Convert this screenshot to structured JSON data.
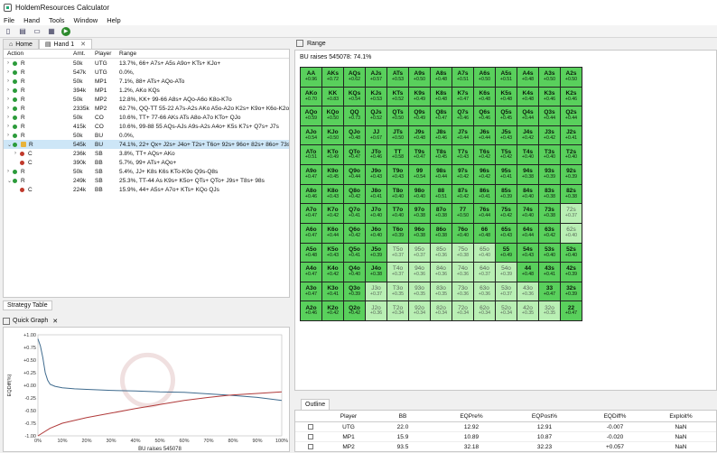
{
  "window": {
    "title": "HoldemResources Calculator"
  },
  "menu": [
    "File",
    "Hand",
    "Tools",
    "Window",
    "Help"
  ],
  "tabs": {
    "home": "Home",
    "hand": "Hand 1"
  },
  "tree": {
    "headers": {
      "action": "Action",
      "amt": "Amt.",
      "player": "Player",
      "range": "Range"
    },
    "rows": [
      {
        "indent": 0,
        "exp": "›",
        "dot": "g",
        "action": "R",
        "amt": "50k",
        "player": "UTG",
        "range": "13.7%, 66+ A7s+ A5s A9o+ KTs+ KJo+"
      },
      {
        "indent": 0,
        "exp": "›",
        "dot": "g",
        "action": "R",
        "amt": "547k",
        "player": "UTG",
        "range": "0.0%,"
      },
      {
        "indent": 0,
        "exp": "›",
        "dot": "g",
        "action": "R",
        "amt": "50k",
        "player": "MP1",
        "range": "7.1%, 88+ ATs+ AQo-ATo"
      },
      {
        "indent": 0,
        "exp": "›",
        "dot": "g",
        "action": "R",
        "amt": "394k",
        "player": "MP1",
        "range": "1.2%, AKo KQs"
      },
      {
        "indent": 0,
        "exp": "›",
        "dot": "g",
        "action": "R",
        "amt": "50k",
        "player": "MP2",
        "range": "12.8%, KK+ 99-66 A8s+ AQo-A6o K8o-K7o"
      },
      {
        "indent": 0,
        "exp": "›",
        "dot": "g",
        "action": "R",
        "amt": "2335k",
        "player": "MP2",
        "range": "62.7%, QQ-TT 55-22 A7s-A2s AKo A5o-A2o K2s+ K9o+ K6o-K2o"
      },
      {
        "indent": 0,
        "exp": "›",
        "dot": "g",
        "action": "R",
        "amt": "50k",
        "player": "CO",
        "range": "10.6%, TT+ 77-66 AKs ATs A8o-A7o KTo+ QJo"
      },
      {
        "indent": 0,
        "exp": "›",
        "dot": "g",
        "action": "R",
        "amt": "415k",
        "player": "CO",
        "range": "10.6%, 99-88 55 AQs-AJs A9s-A2s A4o+ K5s K7s+ Q7s+ J7s"
      },
      {
        "indent": 0,
        "exp": "›",
        "dot": "g",
        "action": "R",
        "amt": "50k",
        "player": "BU",
        "range": "0.0%,"
      },
      {
        "indent": 0,
        "exp": "⌄",
        "dot": "g",
        "action": "R",
        "amt": "545k",
        "player": "BU",
        "range": "74.1%, 22+ Qx+ J2s+ J4o+ T2s+ T6o+ 92s+ 96o+ 82s+ 86o+ 73s",
        "sel": true,
        "lock": true
      },
      {
        "indent": 1,
        "exp": "›",
        "dot": "r",
        "action": "C",
        "amt": "236k",
        "player": "SB",
        "range": "3.8%, TT+ AQs+ AKo"
      },
      {
        "indent": 1,
        "exp": "",
        "dot": "r",
        "action": "C",
        "amt": "390k",
        "player": "BB",
        "range": "5.7%, 99+ ATs+ AQo+"
      },
      {
        "indent": 0,
        "exp": "›",
        "dot": "g",
        "action": "R",
        "amt": "50k",
        "player": "SB",
        "range": "5.4%, JJ+ K8s K6s KTo-K9o Q9s-Q8s"
      },
      {
        "indent": 0,
        "exp": "⌄",
        "dot": "g",
        "action": "R",
        "amt": "249k",
        "player": "SB",
        "range": "25.3%, TT-44 As K9s+ K5o+ QTs+ QTo+ J9s+ T8s+ 98s"
      },
      {
        "indent": 1,
        "exp": "",
        "dot": "r",
        "action": "C",
        "amt": "224k",
        "player": "BB",
        "range": "15.9%, 44+ A5s+ A7o+ KTs+ KQo QJs"
      }
    ]
  },
  "strategy_tab": "Strategy Table",
  "quick_graph": {
    "label": "Quick Graph"
  },
  "range_pane": {
    "label": "Range",
    "title": "BU raises 545078: 74.1%"
  },
  "range_grid": {
    "cells": [
      [
        "AA",
        "+0.96",
        1
      ],
      [
        "AKs",
        "+0.72",
        1
      ],
      [
        "AQs",
        "+0.62",
        1
      ],
      [
        "AJs",
        "+0.57",
        1
      ],
      [
        "ATs",
        "+0.53",
        1
      ],
      [
        "A9s",
        "+0.50",
        1
      ],
      [
        "A8s",
        "+0.48",
        1
      ],
      [
        "A7s",
        "+0.51",
        1
      ],
      [
        "A6s",
        "+0.50",
        1
      ],
      [
        "A5s",
        "+0.51",
        1
      ],
      [
        "A4s",
        "+0.48",
        1
      ],
      [
        "A3s",
        "+0.50",
        1
      ],
      [
        "A2s",
        "+0.50",
        1
      ],
      [
        "AKo",
        "+0.70",
        1
      ],
      [
        "KK",
        "+0.83",
        1
      ],
      [
        "KQs",
        "+0.54",
        1
      ],
      [
        "KJs",
        "+0.53",
        1
      ],
      [
        "KTs",
        "+0.52",
        1
      ],
      [
        "K9s",
        "+0.49",
        1
      ],
      [
        "K8s",
        "+0.48",
        1
      ],
      [
        "K7s",
        "+0.47",
        1
      ],
      [
        "K6s",
        "+0.48",
        1
      ],
      [
        "K5s",
        "+0.48",
        1
      ],
      [
        "K4s",
        "+0.48",
        1
      ],
      [
        "K3s",
        "+0.46",
        1
      ],
      [
        "K2s",
        "+0.46",
        1
      ],
      [
        "AQo",
        "+0.59",
        1
      ],
      [
        "KQo",
        "+0.50",
        1
      ],
      [
        "QQ",
        "+0.73",
        1
      ],
      [
        "QJs",
        "+0.52",
        1
      ],
      [
        "QTs",
        "+0.50",
        1
      ],
      [
        "Q9s",
        "+0.49",
        1
      ],
      [
        "Q8s",
        "+0.47",
        1
      ],
      [
        "Q7s",
        "+0.46",
        1
      ],
      [
        "Q6s",
        "+0.46",
        1
      ],
      [
        "Q5s",
        "+0.45",
        1
      ],
      [
        "Q4s",
        "+0.44",
        1
      ],
      [
        "Q3s",
        "+0.44",
        1
      ],
      [
        "Q2s",
        "+0.44",
        1
      ],
      [
        "AJo",
        "+0.54",
        1
      ],
      [
        "KJo",
        "+0.50",
        1
      ],
      [
        "QJo",
        "+0.48",
        1
      ],
      [
        "JJ",
        "+0.67",
        1
      ],
      [
        "JTs",
        "+0.50",
        1
      ],
      [
        "J9s",
        "+0.48",
        1
      ],
      [
        "J8s",
        "+0.46",
        1
      ],
      [
        "J7s",
        "+0.44",
        1
      ],
      [
        "J6s",
        "+0.44",
        1
      ],
      [
        "J5s",
        "+0.43",
        1
      ],
      [
        "J4s",
        "+0.42",
        1
      ],
      [
        "J3s",
        "+0.42",
        1
      ],
      [
        "J2s",
        "+0.41",
        1
      ],
      [
        "ATo",
        "+0.51",
        1
      ],
      [
        "KTo",
        "+0.49",
        1
      ],
      [
        "QTo",
        "+0.47",
        1
      ],
      [
        "JTo",
        "+0.46",
        1
      ],
      [
        "TT",
        "+0.58",
        1
      ],
      [
        "T9s",
        "+0.47",
        1
      ],
      [
        "T8s",
        "+0.45",
        1
      ],
      [
        "T7s",
        "+0.43",
        1
      ],
      [
        "T6s",
        "+0.42",
        1
      ],
      [
        "T5s",
        "+0.42",
        1
      ],
      [
        "T4s",
        "+0.40",
        1
      ],
      [
        "T3s",
        "+0.40",
        1
      ],
      [
        "T2s",
        "+0.40",
        1
      ],
      [
        "A9o",
        "+0.47",
        1
      ],
      [
        "K9o",
        "+0.45",
        1
      ],
      [
        "Q9o",
        "+0.44",
        1
      ],
      [
        "J9o",
        "+0.43",
        1
      ],
      [
        "T9o",
        "+0.43",
        1
      ],
      [
        "99",
        "+0.54",
        1
      ],
      [
        "98s",
        "+0.44",
        1
      ],
      [
        "97s",
        "+0.42",
        1
      ],
      [
        "96s",
        "+0.42",
        1
      ],
      [
        "95s",
        "+0.41",
        1
      ],
      [
        "94s",
        "+0.38",
        1
      ],
      [
        "93s",
        "+0.39",
        1
      ],
      [
        "92s",
        "+0.39",
        1
      ],
      [
        "A8o",
        "+0.46",
        1
      ],
      [
        "K8o",
        "+0.43",
        1
      ],
      [
        "Q8o",
        "+0.42",
        1
      ],
      [
        "J8o",
        "+0.41",
        1
      ],
      [
        "T8o",
        "+0.40",
        1
      ],
      [
        "98o",
        "+0.40",
        1
      ],
      [
        "88",
        "+0.51",
        1
      ],
      [
        "87s",
        "+0.42",
        1
      ],
      [
        "86s",
        "+0.41",
        1
      ],
      [
        "85s",
        "+0.39",
        1
      ],
      [
        "84s",
        "+0.40",
        1
      ],
      [
        "83s",
        "+0.38",
        1
      ],
      [
        "82s",
        "+0.38",
        1
      ],
      [
        "A7o",
        "+0.47",
        1
      ],
      [
        "K7o",
        "+0.42",
        1
      ],
      [
        "Q7o",
        "+0.41",
        1
      ],
      [
        "J7o",
        "+0.40",
        1
      ],
      [
        "T7o",
        "+0.40",
        1
      ],
      [
        "97o",
        "+0.38",
        1
      ],
      [
        "87o",
        "+0.38",
        1
      ],
      [
        "77",
        "+0.50",
        1
      ],
      [
        "76s",
        "+0.44",
        1
      ],
      [
        "75s",
        "+0.42",
        1
      ],
      [
        "74s",
        "+0.40",
        1
      ],
      [
        "73s",
        "+0.38",
        1
      ],
      [
        "72s",
        "+0.37",
        0
      ],
      [
        "A6o",
        "+0.47",
        1
      ],
      [
        "K6o",
        "+0.44",
        1
      ],
      [
        "Q6o",
        "+0.42",
        1
      ],
      [
        "J6o",
        "+0.40",
        1
      ],
      [
        "T6o",
        "+0.39",
        1
      ],
      [
        "96o",
        "+0.38",
        1
      ],
      [
        "86o",
        "+0.38",
        1
      ],
      [
        "76o",
        "+0.40",
        1
      ],
      [
        "66",
        "+0.48",
        1
      ],
      [
        "65s",
        "+0.43",
        1
      ],
      [
        "64s",
        "+0.44",
        1
      ],
      [
        "63s",
        "+0.42",
        1
      ],
      [
        "62s",
        "+0.40",
        0
      ],
      [
        "A5o",
        "+0.48",
        1
      ],
      [
        "K5o",
        "+0.43",
        1
      ],
      [
        "Q5o",
        "+0.41",
        1
      ],
      [
        "J5o",
        "+0.39",
        1
      ],
      [
        "T5o",
        "+0.37",
        0
      ],
      [
        "95o",
        "+0.37",
        0
      ],
      [
        "85o",
        "+0.36",
        0
      ],
      [
        "75o",
        "+0.38",
        0
      ],
      [
        "65o",
        "+0.40",
        0
      ],
      [
        "55",
        "+0.49",
        1
      ],
      [
        "54s",
        "+0.43",
        1
      ],
      [
        "53s",
        "+0.40",
        1
      ],
      [
        "52s",
        "+0.40",
        1
      ],
      [
        "A4o",
        "+0.47",
        1
      ],
      [
        "K4o",
        "+0.42",
        1
      ],
      [
        "Q4o",
        "+0.40",
        1
      ],
      [
        "J4o",
        "+0.38",
        1
      ],
      [
        "T4o",
        "+0.37",
        0
      ],
      [
        "94o",
        "+0.36",
        0
      ],
      [
        "84o",
        "+0.36",
        0
      ],
      [
        "74o",
        "+0.36",
        0
      ],
      [
        "64o",
        "+0.37",
        0
      ],
      [
        "54o",
        "+0.39",
        0
      ],
      [
        "44",
        "+0.48",
        1
      ],
      [
        "43s",
        "+0.41",
        1
      ],
      [
        "42s",
        "+0.39",
        1
      ],
      [
        "A3o",
        "+0.47",
        1
      ],
      [
        "K3o",
        "+0.41",
        1
      ],
      [
        "Q3o",
        "+0.39",
        1
      ],
      [
        "J3o",
        "+0.37",
        0
      ],
      [
        "T3o",
        "+0.35",
        0
      ],
      [
        "93o",
        "+0.35",
        0
      ],
      [
        "83o",
        "+0.35",
        0
      ],
      [
        "73o",
        "+0.36",
        0
      ],
      [
        "63o",
        "+0.36",
        0
      ],
      [
        "53o",
        "+0.37",
        0
      ],
      [
        "43o",
        "+0.36",
        0
      ],
      [
        "33",
        "+0.47",
        1
      ],
      [
        "32s",
        "+0.39",
        1
      ],
      [
        "A2o",
        "+0.46",
        1
      ],
      [
        "K2o",
        "+0.42",
        1
      ],
      [
        "Q2o",
        "+0.42",
        1
      ],
      [
        "J2o",
        "+0.36",
        0
      ],
      [
        "T2o",
        "+0.34",
        0
      ],
      [
        "92o",
        "+0.34",
        0
      ],
      [
        "82o",
        "+0.34",
        0
      ],
      [
        "72o",
        "+0.34",
        0
      ],
      [
        "62o",
        "+0.34",
        0
      ],
      [
        "52o",
        "+0.34",
        0
      ],
      [
        "42o",
        "+0.35",
        0
      ],
      [
        "32o",
        "+0.35",
        0
      ],
      [
        "22",
        "+0.47",
        1
      ]
    ]
  },
  "chart_data": {
    "type": "line",
    "xlabel": "BU raises 545078",
    "ylabel": "EQDiff(%)",
    "ylim": [
      -1.0,
      1.0
    ],
    "yticks": [
      "+1.00",
      "+0.75",
      "+0.50",
      "+0.25",
      "+0.00",
      "-0.25",
      "-0.50",
      "-0.75",
      "-1.00"
    ],
    "xticks": [
      "0%",
      "10%",
      "20%",
      "30%",
      "40%",
      "50%",
      "60%",
      "70%",
      "80%",
      "90%",
      "100%"
    ],
    "series": [
      {
        "color": "#3f6b8e",
        "x": [
          0,
          1,
          2,
          3,
          4,
          5,
          7,
          10,
          15,
          20,
          30,
          40,
          50,
          60,
          70,
          80,
          90,
          100
        ],
        "y": [
          0.92,
          0.78,
          0.55,
          0.25,
          0.1,
          0.02,
          -0.02,
          -0.05,
          -0.07,
          -0.08,
          -0.1,
          -0.11,
          -0.13,
          -0.14,
          -0.17,
          -0.2,
          -0.24,
          -0.3
        ]
      },
      {
        "color": "#b03a3a",
        "x": [
          0,
          5,
          10,
          20,
          30,
          40,
          50,
          60,
          70,
          80,
          90,
          100
        ],
        "y": [
          -1.0,
          -0.85,
          -0.75,
          -0.64,
          -0.55,
          -0.46,
          -0.38,
          -0.3,
          -0.24,
          -0.19,
          -0.16,
          -0.13
        ]
      }
    ]
  },
  "outline": {
    "tab": "Outline",
    "headers": {
      "player": "Player",
      "bb": "BB",
      "eqpre": "EQPre%",
      "eqpost": "EQPost%",
      "eqdiff": "EQDiff%",
      "exploit": "Exploit%"
    },
    "rows": [
      {
        "player": "UTG",
        "bb": "22.0",
        "eqpre": "12.92",
        "eqpost": "12.91",
        "eqdiff": "-0.007",
        "exploit": "NaN"
      },
      {
        "player": "MP1",
        "bb": "15.9",
        "eqpre": "10.89",
        "eqpost": "10.87",
        "eqdiff": "-0.020",
        "exploit": "NaN"
      },
      {
        "player": "MP2",
        "bb": "93.5",
        "eqpre": "32.18",
        "eqpost": "32.23",
        "eqdiff": "+0.057",
        "exploit": "NaN"
      }
    ]
  }
}
